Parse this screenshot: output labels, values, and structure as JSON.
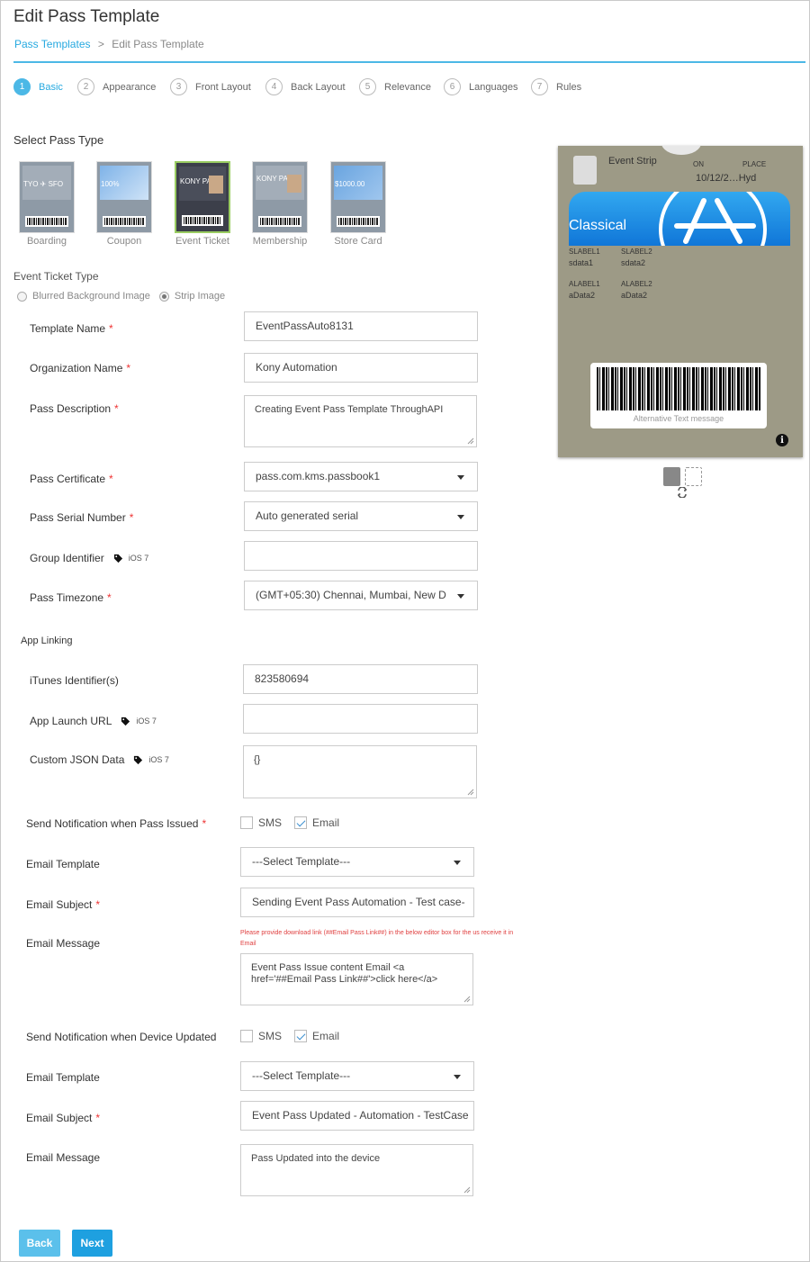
{
  "page": {
    "title": "Edit Pass Template",
    "breadcrumb": {
      "link": "Pass Templates",
      "sep": ">",
      "current": "Edit Pass Template"
    }
  },
  "steps": [
    {
      "num": "1",
      "label": "Basic"
    },
    {
      "num": "2",
      "label": "Appearance"
    },
    {
      "num": "3",
      "label": "Front Layout"
    },
    {
      "num": "4",
      "label": "Back Layout"
    },
    {
      "num": "5",
      "label": "Relevance"
    },
    {
      "num": "6",
      "label": "Languages"
    },
    {
      "num": "7",
      "label": "Rules"
    }
  ],
  "pass_type": {
    "title": "Select Pass Type",
    "types": [
      "Boarding",
      "Coupon",
      "Event Ticket",
      "Membership",
      "Store Card"
    ],
    "thumb_texts": [
      "TYO ✈ SFO",
      "100%",
      "KONY PASS",
      "KONY PASS",
      "$1000.00"
    ],
    "selected": "Event Ticket"
  },
  "event_ticket_type": {
    "title": "Event Ticket Type",
    "options": [
      "Blurred Background Image",
      "Strip Image"
    ],
    "selected": "Strip Image"
  },
  "form": {
    "template_name": {
      "label": "Template Name",
      "req": "*",
      "value": "EventPassAuto8131"
    },
    "org_name": {
      "label": "Organization Name",
      "req": "*",
      "value": "Kony Automation"
    },
    "pass_desc": {
      "label": "Pass Description",
      "req": "*",
      "value": "Creating Event Pass Template ThroughAPI"
    },
    "pass_cert": {
      "label": "Pass Certificate",
      "req": "*",
      "value": "pass.com.kms.passbook1"
    },
    "serial": {
      "label": "Pass Serial Number",
      "req": "*",
      "value": "Auto generated serial"
    },
    "group_id": {
      "label": "Group Identifier",
      "ios": "iOS 7",
      "value": ""
    },
    "timezone": {
      "label": "Pass Timezone",
      "req": "*",
      "value": "(GMT+05:30) Chennai, Mumbai, New D"
    },
    "app_linking": "App Linking",
    "itunes": {
      "label": "iTunes Identifier(s)",
      "value": "823580694"
    },
    "launch_url": {
      "label": "App Launch URL",
      "ios": "iOS 7",
      "value": ""
    },
    "custom_json": {
      "label": "Custom JSON Data",
      "ios": "iOS 7",
      "value": "{}"
    }
  },
  "issued": {
    "label": "Send Notification when Pass Issued",
    "req": "*",
    "sms": "SMS",
    "email": "Email",
    "email_template": {
      "label": "Email Template",
      "value": "---Select Template---"
    },
    "email_subject": {
      "label": "Email Subject",
      "req": "*",
      "value": "Sending Event Pass Automation - Test case-"
    },
    "email_message": {
      "label": "Email Message",
      "hint": "Please provide download link (##Email Pass Link##) in the below editor box for the us receive it in Email",
      "value": "Event Pass Issue content Email <a href='##Email Pass Link##'>click here</a>"
    }
  },
  "updated": {
    "label": "Send Notification when Device Updated",
    "sms": "SMS",
    "email": "Email",
    "email_template": {
      "label": "Email Template",
      "value": "---Select Template---"
    },
    "email_subject": {
      "label": "Email Subject",
      "req": "*",
      "value": "Event Pass Updated - Automation - TestCase"
    },
    "email_message": {
      "label": "Email Message",
      "value": "Pass Updated into the device"
    }
  },
  "buttons": {
    "back": "Back",
    "next": "Next"
  },
  "preview": {
    "logo_text": "Event Strip",
    "header_on_label": "ON",
    "header_place_label": "PLACE",
    "header_value": "10/12/2…Hyd",
    "strip_text": "Classical",
    "slabel1": "SLABEL1",
    "sdata1": "sdata1",
    "slabel2": "SLABEL2",
    "sdata2": "sdata2",
    "alabel1": "ALABEL1",
    "adata1": "aData2",
    "alabel2": "ALABEL2",
    "adata2": "aData2",
    "alt_text": "Alternative Text message",
    "info": "i"
  }
}
